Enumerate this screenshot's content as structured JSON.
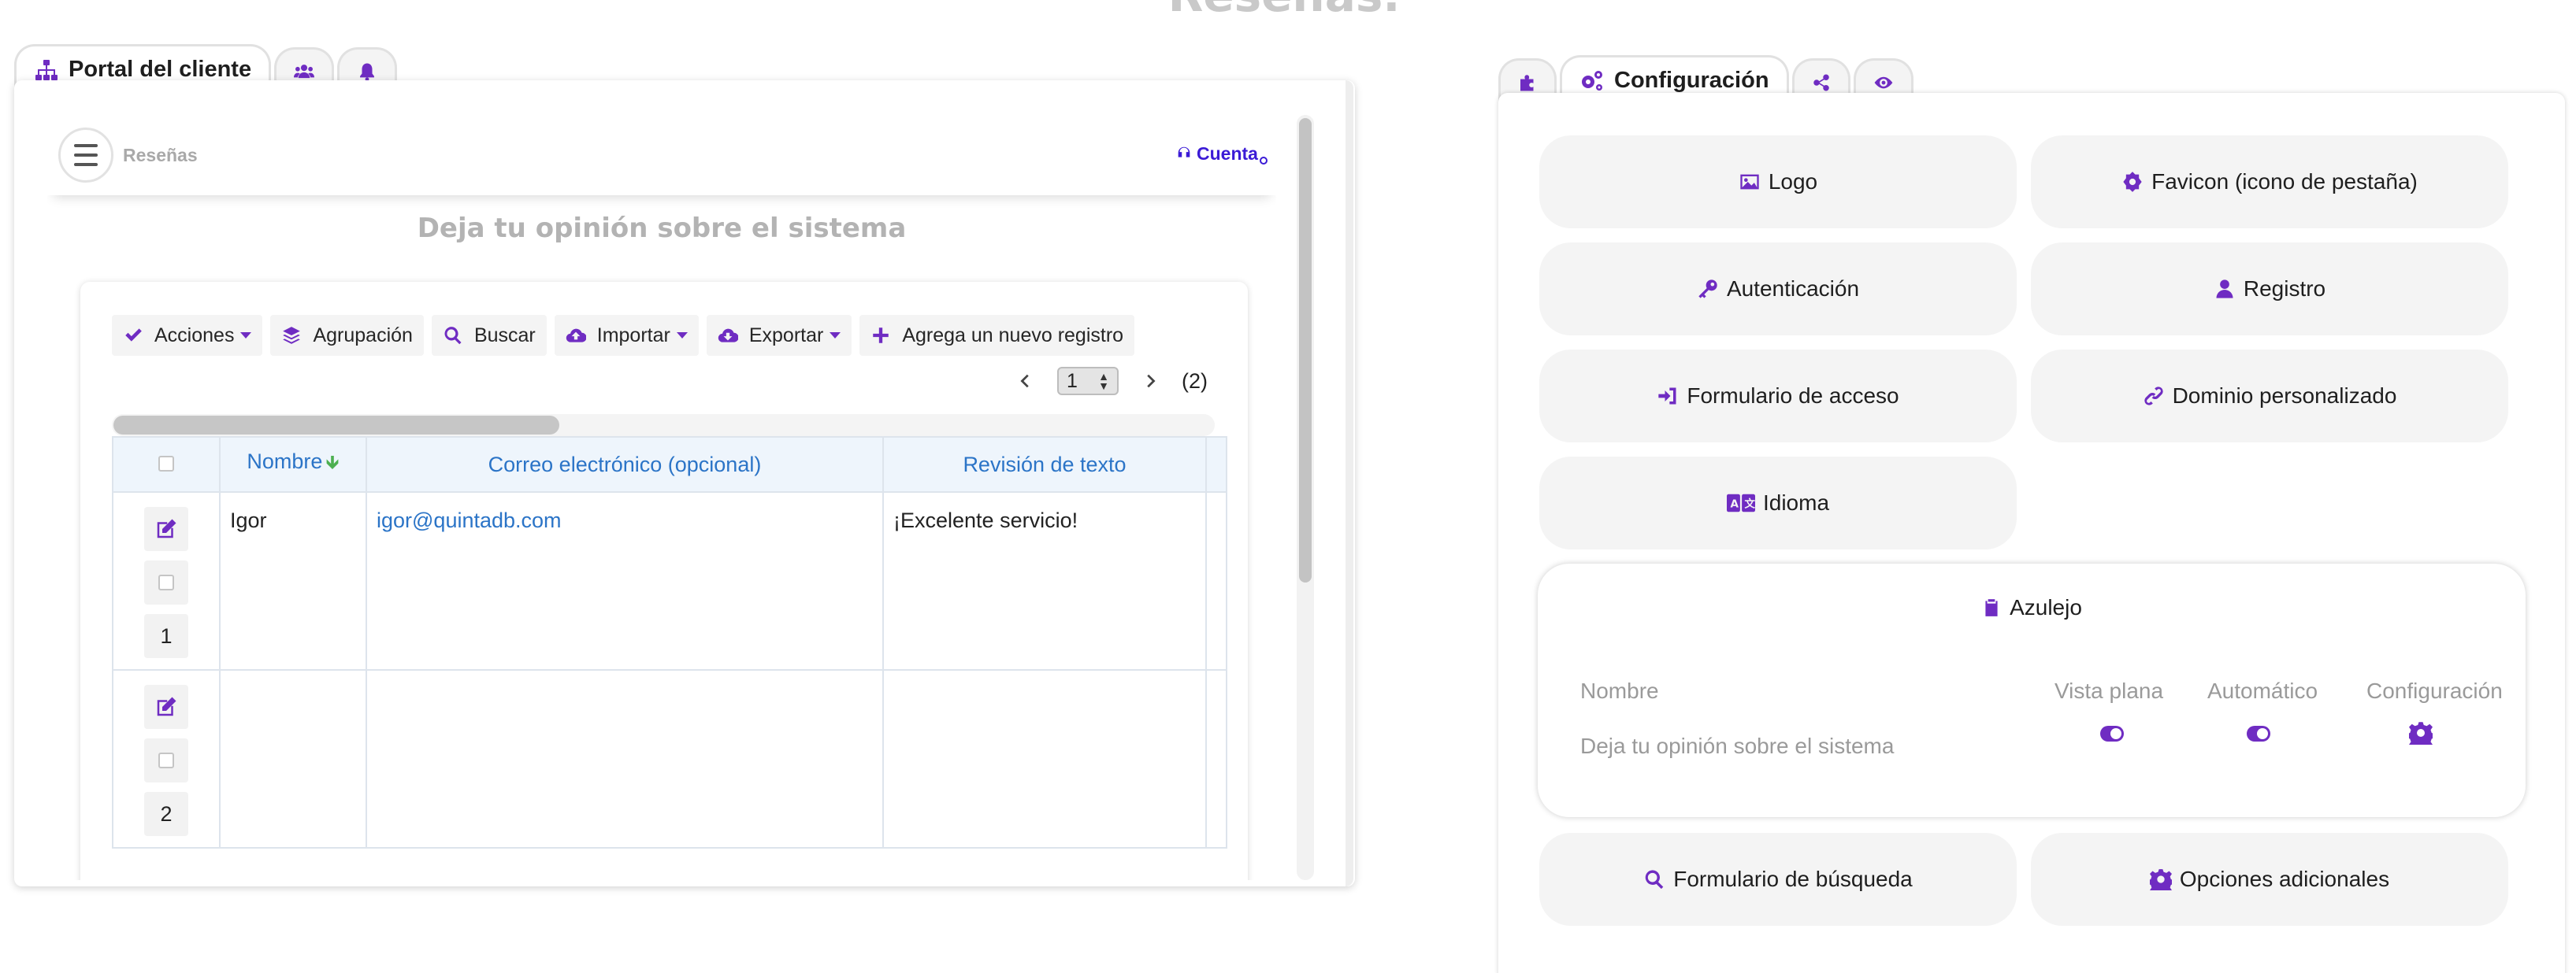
{
  "page": {
    "heading": "Reseñas."
  },
  "left_tabs": [
    {
      "label": "Portal del cliente",
      "icon": "sitemap-icon"
    },
    {
      "label": "",
      "icon": "users-icon"
    },
    {
      "label": "",
      "icon": "bell-icon"
    }
  ],
  "portal": {
    "header_title": "Reseñas",
    "account_label": "Cuenta",
    "form_title": "Deja tu opinión sobre el sistema",
    "toolbar": {
      "actions": "Acciones",
      "grouping": "Agrupación",
      "search": "Buscar",
      "import": "Importar",
      "export": "Exportar",
      "add_record": "Agrega un nuevo registro"
    },
    "pager": {
      "current_page": "1",
      "record_count": "(2)"
    },
    "columns": [
      "Nombre",
      "Correo electrónico (opcional)",
      "Revisión de texto"
    ],
    "rows": [
      {
        "number": "1",
        "name": "Igor",
        "email": "igor@quintadb.com",
        "review": "¡Excelente servicio!"
      },
      {
        "number": "2",
        "name": "",
        "email": "",
        "review": ""
      }
    ]
  },
  "right_tabs": [
    {
      "label": "",
      "icon": "puzzle-icon"
    },
    {
      "label": "Configuración",
      "icon": "cogs-icon"
    },
    {
      "label": "",
      "icon": "share-icon"
    },
    {
      "label": "",
      "icon": "eye-icon"
    }
  ],
  "config": {
    "logo": "Logo",
    "favicon": "Favicon (icono de pestaña)",
    "auth": "Autenticación",
    "registration": "Registro",
    "login_form": "Formulario de acceso",
    "custom_domain": "Dominio personalizado",
    "language": "Idioma",
    "search_form": "Formulario de búsqueda",
    "extra_options": "Opciones adicionales",
    "tile": {
      "title": "Azulejo",
      "col_name": "Nombre",
      "col_flat": "Vista plana",
      "col_auto": "Automático",
      "col_config": "Configuración",
      "row_name": "Deja tu opinión sobre el sistema",
      "flat_view_on": true,
      "automatic_on": true
    }
  },
  "colors": {
    "accent": "#6f2cc2",
    "link": "#2b74c7",
    "account": "#3b1bd6"
  }
}
